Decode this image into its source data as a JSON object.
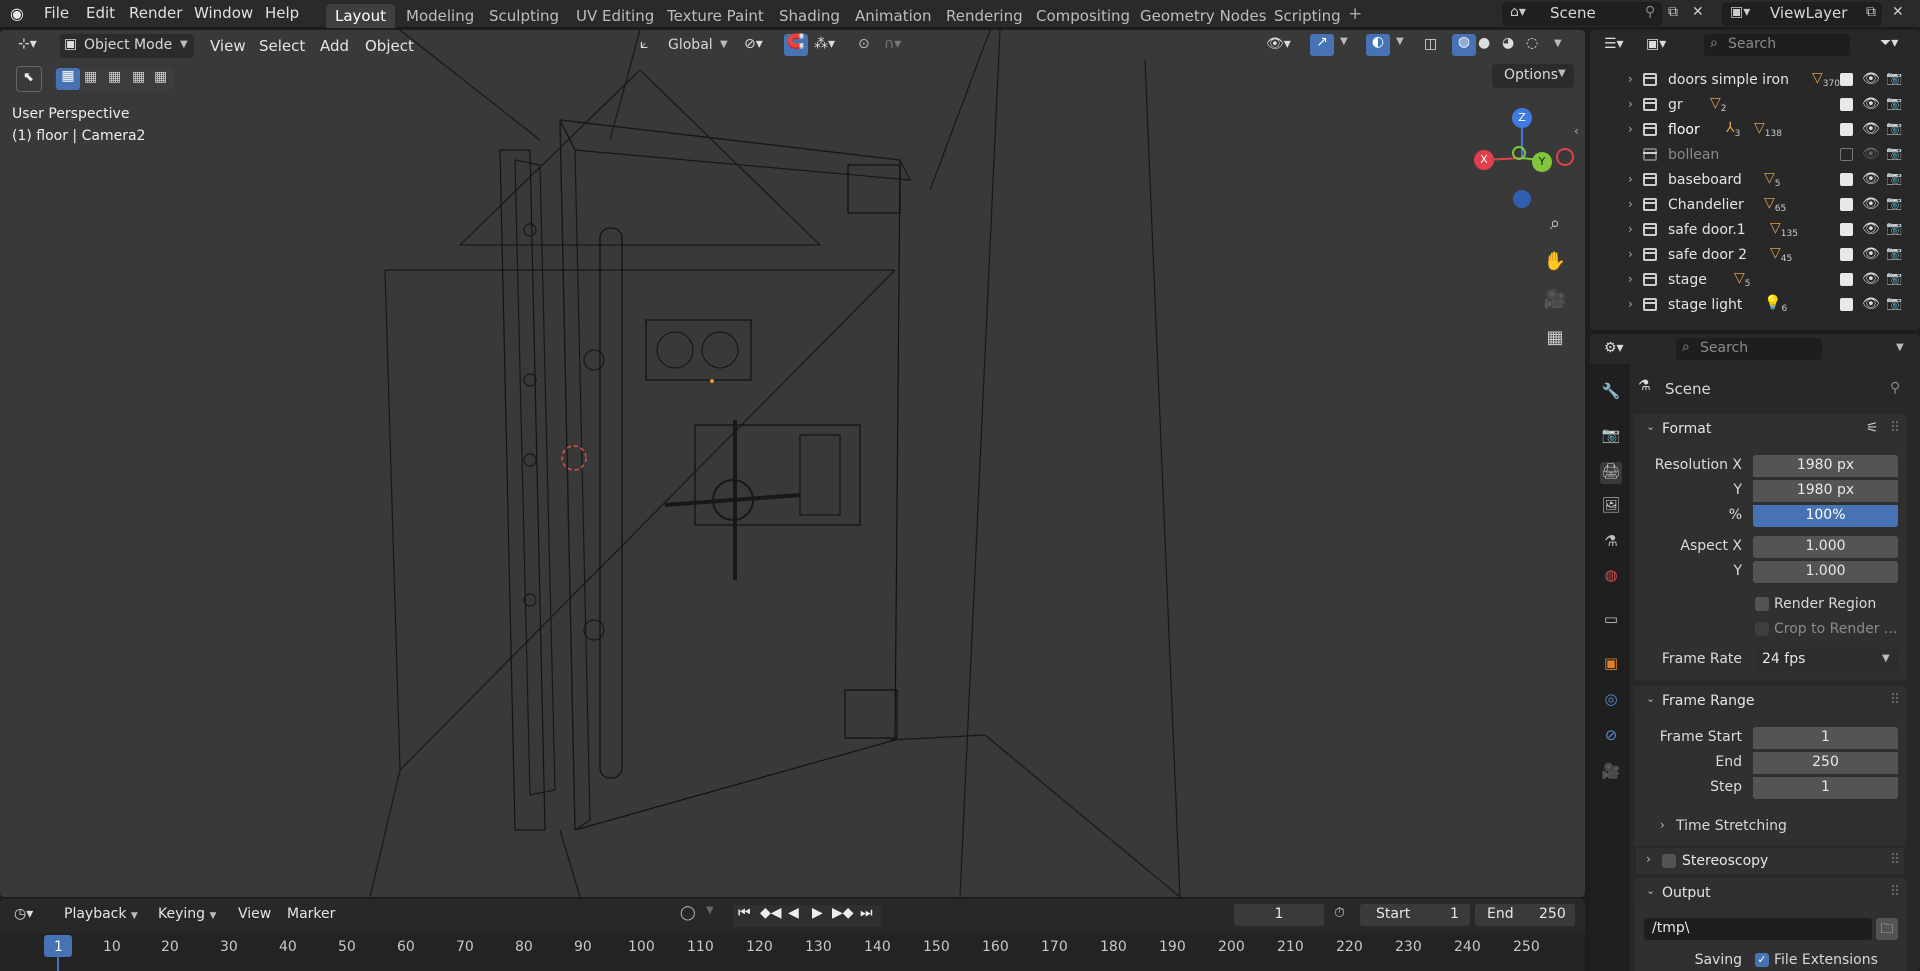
{
  "menu": [
    "File",
    "Edit",
    "Render",
    "Window",
    "Help"
  ],
  "workspaces": [
    "Layout",
    "Modeling",
    "Sculpting",
    "UV Editing",
    "Texture Paint",
    "Shading",
    "Animation",
    "Rendering",
    "Compositing",
    "Geometry Nodes",
    "Scripting"
  ],
  "active_workspace": "Layout",
  "scene_name": "Scene",
  "view_layer": "ViewLayer",
  "viewport_header": {
    "mode": "Object Mode",
    "view": "View",
    "select": "Select",
    "add": "Add",
    "object": "Object",
    "transform": "Global",
    "options": "Options"
  },
  "viewport_overlay": {
    "perspective": "User Perspective",
    "object_info": "(1) floor | Camera2"
  },
  "gizmo": {
    "x": "X",
    "y": "Y",
    "z": "Z"
  },
  "outliner": {
    "search_placeholder": "Search",
    "items": [
      {
        "name": "doors simple iron",
        "count": "370",
        "visible": true
      },
      {
        "name": "gr",
        "count": "2",
        "visible": true
      },
      {
        "name": "floor",
        "count": "3",
        "count2": "138",
        "visible": true
      },
      {
        "name": "bollean",
        "count": "",
        "visible": false
      },
      {
        "name": "baseboard",
        "count": "5",
        "visible": true
      },
      {
        "name": "Chandelier",
        "count": "65",
        "visible": true
      },
      {
        "name": "safe door.1",
        "count": "135",
        "visible": true
      },
      {
        "name": "safe door 2",
        "count": "45",
        "visible": true
      },
      {
        "name": "stage",
        "count": "5",
        "visible": true
      },
      {
        "name": "stage light",
        "count": "6",
        "visible": true
      }
    ]
  },
  "properties": {
    "search_placeholder": "Search",
    "context": "Scene",
    "format_title": "Format",
    "resolution_x_label": "Resolution X",
    "resolution_x": "1980 px",
    "resolution_y_label": "Y",
    "resolution_y": "1980 px",
    "percent_label": "%",
    "percent": "100%",
    "aspect_x_label": "Aspect X",
    "aspect_x": "1.000",
    "aspect_y_label": "Y",
    "aspect_y": "1.000",
    "render_region": "Render Region",
    "crop": "Crop to Render ...",
    "frame_rate_label": "Frame Rate",
    "frame_rate": "24 fps",
    "frame_range_title": "Frame Range",
    "frame_start_label": "Frame Start",
    "frame_start": "1",
    "end_label": "End",
    "end": "250",
    "step_label": "Step",
    "step": "1",
    "time_stretching": "Time Stretching",
    "stereoscopy": "Stereoscopy",
    "output_title": "Output",
    "output_path": "/tmp\\",
    "saving_label": "Saving",
    "file_extensions": "File Extensions"
  },
  "timeline": {
    "playback": "Playback",
    "keying": "Keying",
    "view": "View",
    "marker": "Marker",
    "current_frame": "1",
    "start_label": "Start",
    "start": "1",
    "end_label": "End",
    "end": "250",
    "ticks": [
      "1",
      "10",
      "20",
      "30",
      "40",
      "50",
      "60",
      "70",
      "80",
      "90",
      "100",
      "110",
      "120",
      "130",
      "140",
      "150",
      "160",
      "170",
      "180",
      "190",
      "200",
      "210",
      "220",
      "230",
      "240",
      "250"
    ]
  },
  "colors": {
    "accent": "#4772b3",
    "axis_x": "#e0404c",
    "axis_y": "#7fc63d",
    "axis_z": "#3d7be0",
    "mesh_badge": "#d9a04a"
  }
}
